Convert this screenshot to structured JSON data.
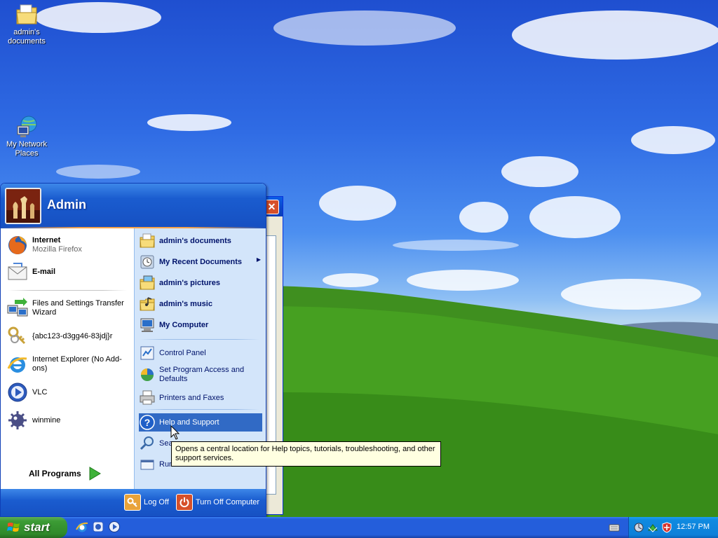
{
  "desktop_icons": [
    {
      "label": "admin's\ndocuments",
      "icon": "folder-documents-icon"
    },
    {
      "label": "My Network Places",
      "icon": "network-places-icon"
    }
  ],
  "start_menu": {
    "username": "Admin",
    "pinned": [
      {
        "title": "Internet",
        "subtitle": "Mozilla Firefox",
        "icon": "firefox-icon"
      },
      {
        "title": "E-mail",
        "subtitle": "",
        "icon": "email-icon"
      }
    ],
    "recent": [
      {
        "label": "Files and Settings Transfer Wizard",
        "icon": "transfer-wizard-icon"
      },
      {
        "label": "{abc123-d3gg46-83jdj}r",
        "icon": "keys-icon"
      },
      {
        "label": "Internet Explorer (No Add-ons)",
        "icon": "internet-explorer-icon"
      },
      {
        "label": "VLC",
        "icon": "vlc-icon"
      },
      {
        "label": "winmine",
        "icon": "winmine-icon"
      }
    ],
    "all_programs": "All Programs",
    "places": [
      {
        "label": "admin's documents",
        "icon": "folder-documents-icon"
      },
      {
        "label": "My Recent Documents",
        "icon": "recent-documents-icon"
      },
      {
        "label": "admin's pictures",
        "icon": "folder-pictures-icon"
      },
      {
        "label": "admin's music",
        "icon": "folder-music-icon"
      },
      {
        "label": "My Computer",
        "icon": "my-computer-icon"
      }
    ],
    "settings": [
      {
        "label": "Control Panel",
        "icon": "control-panel-icon"
      },
      {
        "label": "Set Program Access and Defaults",
        "icon": "program-defaults-icon"
      },
      {
        "label": "Printers and Faxes",
        "icon": "printer-icon"
      }
    ],
    "help": [
      {
        "label": "Help and Support",
        "icon": "help-icon"
      },
      {
        "label": "Search",
        "visible": "Sea",
        "icon": "search-icon"
      },
      {
        "label": "Run...",
        "visible": "Run",
        "icon": "run-icon"
      }
    ],
    "footer": {
      "log_off": "Log Off",
      "turn_off": "Turn Off Computer"
    }
  },
  "tooltip": "Opens a central location for Help topics, tutorials, troubleshooting, and other support services.",
  "taskbar": {
    "start_label": "start",
    "clock": "12:57 PM"
  },
  "colors": {
    "highlight": "#316ac5",
    "taskbar": "#245edb",
    "start_button": "#3c9c35"
  }
}
